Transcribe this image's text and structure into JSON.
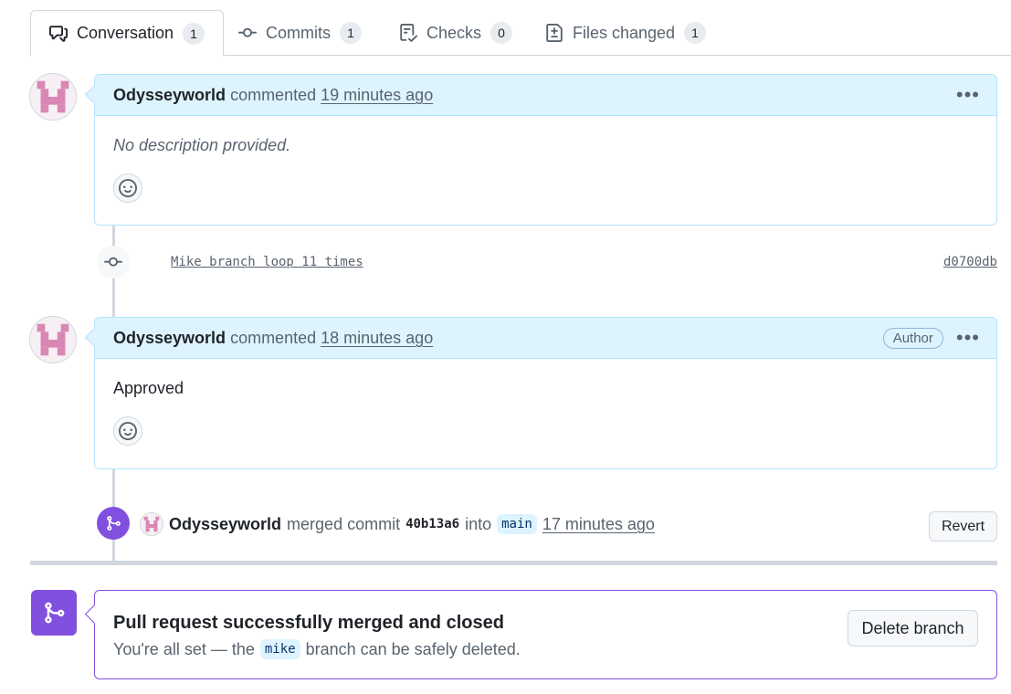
{
  "tabs": [
    {
      "label": "Conversation",
      "count": "1",
      "icon": "comment-discussion-icon"
    },
    {
      "label": "Commits",
      "count": "1",
      "icon": "git-commit-icon"
    },
    {
      "label": "Checks",
      "count": "0",
      "icon": "checklist-icon"
    },
    {
      "label": "Files changed",
      "count": "1",
      "icon": "file-diff-icon"
    }
  ],
  "comments": [
    {
      "author": "Odysseyworld",
      "action": "commented",
      "time": "19 minutes ago",
      "body": "No description provided.",
      "badge": ""
    },
    {
      "author": "Odysseyworld",
      "action": "commented",
      "time": "18 minutes ago",
      "body": "Approved",
      "badge": "Author"
    }
  ],
  "commit": {
    "message": "Mike branch loop 11 times",
    "sha": "d0700db"
  },
  "merge_event": {
    "author": "Odysseyworld",
    "action": "merged commit",
    "sha": "40b13a6",
    "into": "into",
    "branch": "main",
    "time": "17 minutes ago",
    "revert_label": "Revert"
  },
  "merged_box": {
    "title": "Pull request successfully merged and closed",
    "sub_before": "You're all set — the",
    "branch": "mike",
    "sub_after": "branch can be safely deleted.",
    "delete_label": "Delete branch"
  },
  "colors": {
    "merged": "#8250df",
    "comment_header": "#ddf4ff",
    "avatar_pink": "#d987b4"
  }
}
